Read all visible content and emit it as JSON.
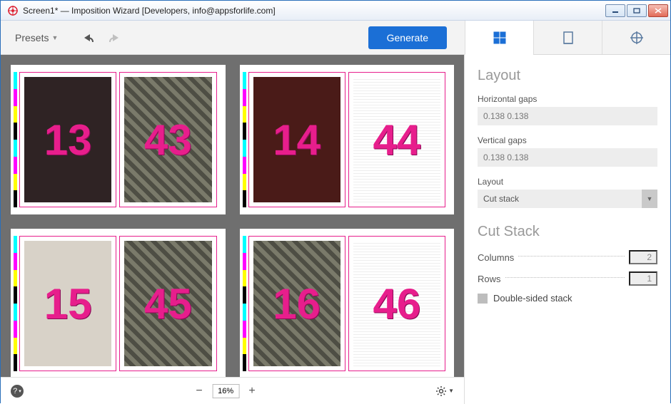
{
  "window": {
    "title": "Screen1* — Imposition Wizard [Developers, info@appsforlife.com]"
  },
  "toolbar": {
    "presets_label": "Presets",
    "generate_label": "Generate"
  },
  "preview": {
    "sheets": [
      {
        "left": "13",
        "right": "43"
      },
      {
        "left": "14",
        "right": "44"
      },
      {
        "left": "15",
        "right": "45"
      },
      {
        "left": "16",
        "right": "46"
      }
    ],
    "zoom": "16%"
  },
  "side": {
    "tabs": [
      "layout",
      "page",
      "registration"
    ],
    "layout_section": {
      "title": "Layout",
      "h_gaps_label": "Horizontal gaps",
      "h_gaps_value": "0.138 0.138",
      "v_gaps_label": "Vertical gaps",
      "v_gaps_value": "0.138 0.138",
      "layout_label": "Layout",
      "layout_value": "Cut stack"
    },
    "cutstack_section": {
      "title": "Cut Stack",
      "columns_label": "Columns",
      "columns_value": "2",
      "rows_label": "Rows",
      "rows_value": "1",
      "double_sided_label": "Double-sided stack"
    }
  }
}
